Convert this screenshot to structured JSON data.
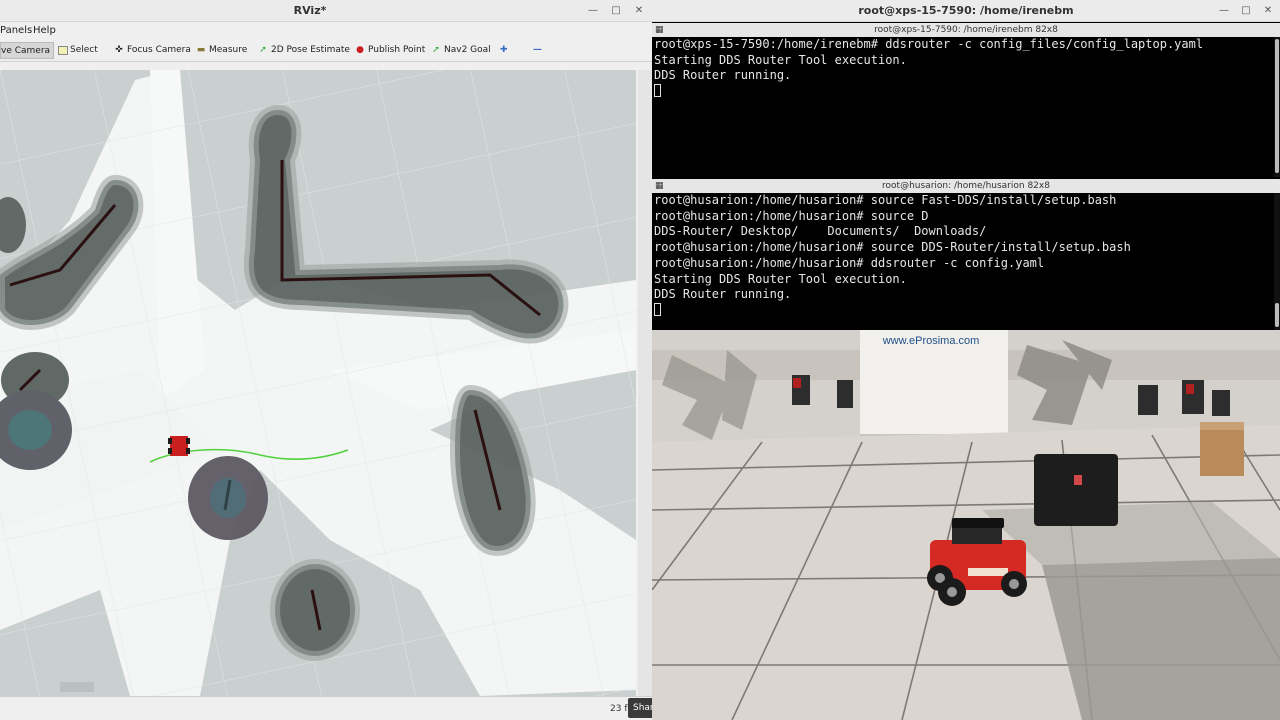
{
  "rviz": {
    "title": "RViz*",
    "menu": [
      "Panels",
      "Help"
    ],
    "tools": [
      {
        "label": "ve Camera",
        "icon": "move-camera-icon",
        "active": true
      },
      {
        "label": "Select",
        "icon": "select-icon"
      },
      {
        "label": "Focus Camera",
        "icon": "focus-camera-icon"
      },
      {
        "label": "Measure",
        "icon": "measure-icon"
      },
      {
        "label": "2D Pose Estimate",
        "icon": "pose-estimate-icon"
      },
      {
        "label": "Publish Point",
        "icon": "publish-point-icon"
      },
      {
        "label": "Nav2 Goal",
        "icon": "nav-goal-icon"
      }
    ],
    "add_tool_icon": "plus-icon",
    "remove_tool_icon": "minus-icon",
    "fps_text": "23 f",
    "share_label": "Share"
  },
  "terminal": {
    "title": "root@xps-15-7590: /home/irenebm",
    "pane1": {
      "header": "root@xps-15-7590: /home/irenebm 82x8",
      "lines": [
        "root@xps-15-7590:/home/irenebm# ddsrouter -c config_files/config_laptop.yaml",
        "Starting DDS Router Tool execution.",
        "DDS Router running."
      ]
    },
    "pane2": {
      "header": "root@husarion: /home/husarion 82x8",
      "lines": [
        "root@husarion:/home/husarion# source Fast-DDS/install/setup.bash",
        "root@husarion:/home/husarion# source D",
        "DDS-Router/ Desktop/    Documents/  Downloads/",
        "root@husarion:/home/husarion# source DDS-Router/install/setup.bash",
        "root@husarion:/home/husarion# ddsrouter -c config.yaml",
        "Starting DDS Router Tool execution.",
        "DDS Router running."
      ]
    }
  },
  "camera": {
    "banner_text": "www.eProsima.com"
  },
  "colors": {
    "map_background": "#c9d0cf",
    "free_space": "#f4f6f6",
    "costmap_dark": "#3c4340",
    "path": "#4fd23a",
    "robot": "#c8201e",
    "terminal_bg": "#000000"
  }
}
